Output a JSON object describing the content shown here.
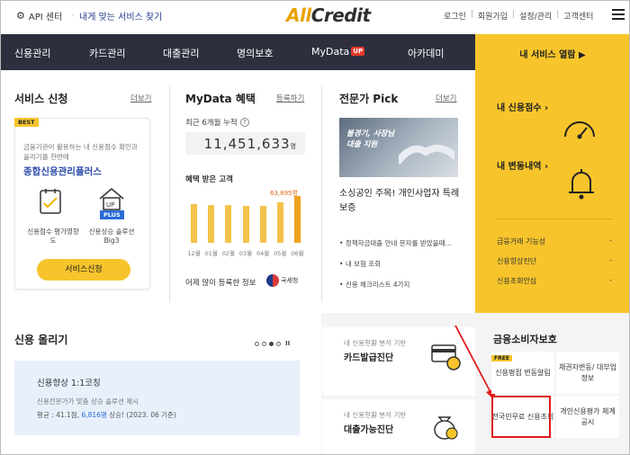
{
  "topbar": {
    "api_label": "API 센터",
    "svc_find": "내게 맞는 서비스 찾기",
    "logo_a": "All",
    "logo_b": "Credit",
    "links": [
      "로그인",
      "회원가입",
      "설정/관리",
      "고객센터"
    ]
  },
  "nav": {
    "items": [
      "신용관리",
      "카드관리",
      "대출관리",
      "명의보호",
      "MyData",
      "아카데미"
    ],
    "up_badge": "UP",
    "my_services": "내 서비스 열람 ▶"
  },
  "service": {
    "title": "서비스 신청",
    "more": "더보기",
    "badge": "BEST",
    "desc": "금융기관이 활용하는 내 신용점수 확인과 올리기를 한번에",
    "name": "종합신용관리플러스",
    "icon1_label": "신용점수 평가영향도",
    "icon2_label": "신용상승 솔루션 Big3",
    "plus_label": "PLUS",
    "button": "서비스신청"
  },
  "mydata": {
    "title": "MyData 혜택",
    "more": "등록하기",
    "sub": "최근 6개월 누적",
    "count": "11,451,633",
    "unit": "명",
    "benefit_label": "혜택 받은 고객",
    "footer": "어제 많이 등록한 정보",
    "nts": "국세청",
    "chart_data": {
      "type": "bar",
      "categories": [
        "12월",
        "01월",
        "02월",
        "03월",
        "04월",
        "05월",
        "06월"
      ],
      "values": [
        52000,
        51500,
        51000,
        50500,
        50000,
        55000,
        63895
      ],
      "highlight_label": "63,895명"
    }
  },
  "pick": {
    "title": "전문가 Pick",
    "more": "더보기",
    "image_text": "불경기, 사장님 대출 지원",
    "headline": "소싱공인 주목! 개인사업자 특례보증",
    "list": [
      "정책자금대출 안내 문자를 받았을때…",
      "내 보험 조회",
      "신용 체크리스트 4가지"
    ]
  },
  "right_panel": {
    "score": "내 신용점수 ›",
    "change": "내 변동내역 ›",
    "rows": [
      "금융거래 기능성",
      "신용향상진단",
      "신용조회안심"
    ],
    "row_mark": "-"
  },
  "bottom": {
    "credit_up_title": "신용 올리기",
    "pause": "II",
    "coach_title": "신용향상 1:1코칭",
    "coach_desc": "신용전문가가 맞춤 상승 솔루션 제시",
    "coach_stat_a": "평균 : 41.1점, ",
    "coach_stat_b": "6,816명",
    "coach_stat_c": " 상승! (2023. 06 기준)",
    "card1_sub": "내 신용현황 분석 기반",
    "card1_title": "카드발급진단",
    "card2_sub": "내 신용현황 분석 기반",
    "card2_title": "대출가능진단",
    "fin_title": "금융소비자보호",
    "free": "FREE",
    "cells": [
      "신용평점 변동알림",
      "채권자변동/ 대부업 정보",
      "전국민무료 신용조회",
      "개인신용평가 체계 공시"
    ]
  }
}
